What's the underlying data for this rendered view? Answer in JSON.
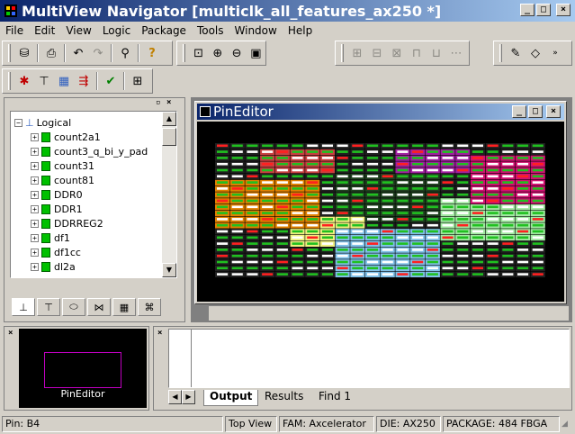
{
  "window": {
    "title": "MultiView Navigator [multiclk_all_features_ax250 *]"
  },
  "menu": [
    "File",
    "Edit",
    "View",
    "Logic",
    "Package",
    "Tools",
    "Window",
    "Help"
  ],
  "tree": {
    "root": "Logical",
    "items": [
      "count2a1",
      "count3_q_bi_y_pad",
      "count31",
      "count81",
      "DDR0",
      "DDR1",
      "DDRREG2",
      "df1",
      "df1cc",
      "dl2a"
    ]
  },
  "pin_editor": {
    "title": "PinEditor"
  },
  "preview": {
    "label": "PinEditor"
  },
  "output_tabs": [
    "Output",
    "Results",
    "Find 1"
  ],
  "status": {
    "pin": "Pin: B4",
    "view": "Top View",
    "family": "FAM: Axcelerator",
    "die": "DIE: AX250",
    "package": "PACKAGE: 484 FBGA"
  },
  "colors": {
    "title_start": "#0a246a",
    "title_end": "#a6caf0",
    "chip_bg": "#000000",
    "selection_box": "#c000c0"
  }
}
